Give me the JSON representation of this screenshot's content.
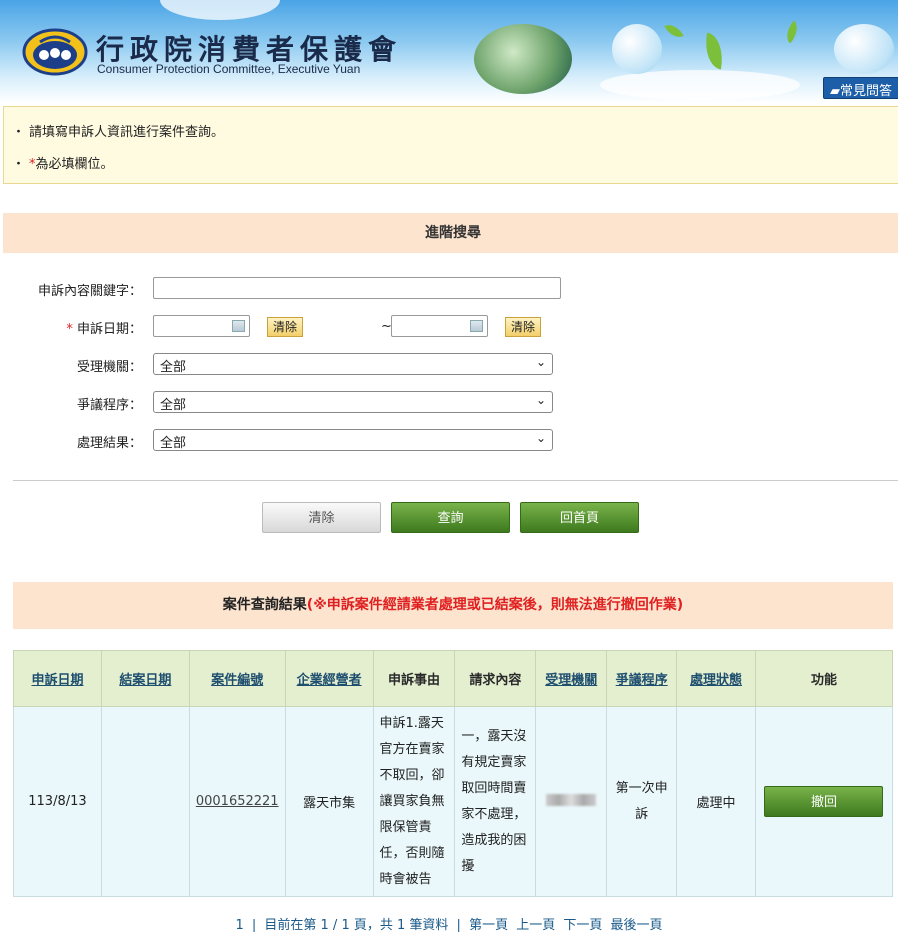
{
  "header": {
    "title_zh": "行政院消費者保護會",
    "title_en": "Consumer Protection Committee, Executive Yuan",
    "faq_label": "常見問答"
  },
  "notice": {
    "line1": "請填寫申訴人資訊進行案件查詢。",
    "line2_star": "*",
    "line2": "為必填欄位。"
  },
  "search": {
    "section_title": "進階搜尋",
    "keyword_label": "申訴內容關鍵字：",
    "keyword_value": "",
    "date_required_star": "*",
    "date_label": "申訴日期：",
    "date_from": "",
    "date_to": "",
    "tilde": "~",
    "clear_small": "清除",
    "agency_label": "受理機關：",
    "agency_value": "全部",
    "procedure_label": "爭議程序：",
    "procedure_value": "全部",
    "result_label": "處理結果：",
    "result_value": "全部"
  },
  "buttons": {
    "clear": "清除",
    "query": "查詢",
    "home": "回首頁"
  },
  "results": {
    "title": "案件查詢結果",
    "warning": "(※申訴案件經請業者處理或已結案後，則無法進行撤回作業)",
    "columns": [
      "申訴日期",
      "結案日期",
      "案件編號",
      "企業經營者",
      "申訴事由",
      "請求內容",
      "受理機關",
      "爭議程序",
      "處理狀態",
      "功能"
    ],
    "rows": [
      {
        "complaint_date": "113/8/13",
        "close_date": "",
        "case_no": "0001652221",
        "business": "露天市集",
        "reason": "申訴1.露天官方在賣家不取回，卻讓買家負無限保管責任，否則隨時會被告",
        "request": "一，露天沒有規定賣家取回時間賣家不處理，造成我的困擾",
        "procedure": "第一次申訴",
        "status": "處理中",
        "action": "撤回"
      }
    ]
  },
  "pager": {
    "page_link": "1",
    "info": "目前在第 1 / 1 頁，共 1 筆資料",
    "first": "第一頁",
    "prev": "上一頁",
    "next": "下一頁",
    "last": "最後一頁"
  }
}
